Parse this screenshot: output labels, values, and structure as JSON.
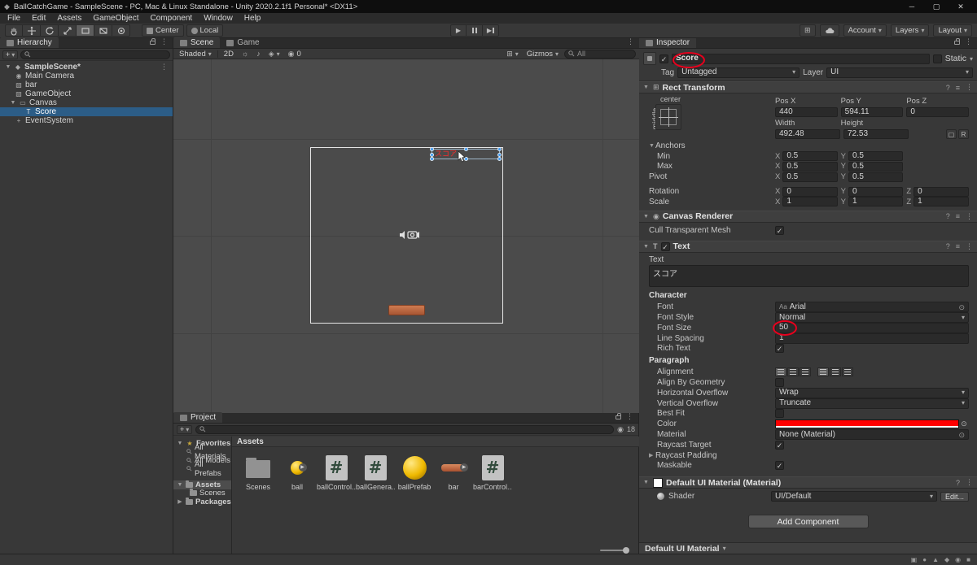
{
  "icons": {
    "chevron_down": "▾",
    "foldout_open": "▼",
    "foldout_closed": "▶",
    "menu_dots": "⋮",
    "check": "✓",
    "help": "?",
    "presets": "≡",
    "close": "✕",
    "minimize": "─",
    "maximize": "▢",
    "star": "★",
    "plus": "+",
    "picker": "⊙",
    "play": "▶",
    "grid": "⊞",
    "light": "☼",
    "audio": "♪",
    "fx": "◈",
    "eye": "◉",
    "unity_logo": "◆",
    "scene_asset": "◆",
    "camera": "◉",
    "cube": "▧",
    "canvas": "▭",
    "text": "T",
    "gear": "+",
    "hash": "#"
  },
  "title_bar": {
    "title": "BallCatchGame - SampleScene - PC, Mac & Linux Standalone - Unity 2020.2.1f1 Personal* <DX11>"
  },
  "menu_bar": {
    "items": [
      "File",
      "Edit",
      "Assets",
      "GameObject",
      "Component",
      "Window",
      "Help"
    ]
  },
  "toolbar": {
    "pivot_button": "Center",
    "rotation_button": "Local",
    "account_button": "Account",
    "layers_button": "Layers",
    "layout_button": "Layout"
  },
  "hierarchy": {
    "tab": "Hierarchy",
    "scene_row": "SampleScene*",
    "rows": [
      {
        "label": "Main Camera"
      },
      {
        "label": "bar"
      },
      {
        "label": "GameObject"
      },
      {
        "label": "Canvas"
      },
      {
        "label": "Score"
      },
      {
        "label": "EventSystem"
      }
    ]
  },
  "scene": {
    "tab_scene": "Scene",
    "tab_game": "Game",
    "shading_dropdown": "Shaded",
    "mode_2d": "2D",
    "hidden_count": "0",
    "gizmos_dropdown": "Gizmos",
    "search_value": "All",
    "score_text": "スコア"
  },
  "project": {
    "tab": "Project",
    "hidden_count": "18",
    "favorites_label": "Favorites",
    "favorites": [
      "All Materials",
      "All Models",
      "All Prefabs"
    ],
    "assets_label": "Assets",
    "scenes_label": "Scenes",
    "packages_label": "Packages",
    "breadcrumb": "Assets",
    "assets": [
      {
        "name": "Scenes",
        "type": "folder"
      },
      {
        "name": "ball",
        "type": "material"
      },
      {
        "name": "ballControl...",
        "type": "script"
      },
      {
        "name": "ballGenera...",
        "type": "script"
      },
      {
        "name": "ballPrefab",
        "type": "prefab"
      },
      {
        "name": "bar",
        "type": "prefab"
      },
      {
        "name": "barControl...",
        "type": "script"
      }
    ]
  },
  "inspector": {
    "tab": "Inspector",
    "name_field": "Score",
    "static_label": "Static",
    "tag_label": "Tag",
    "tag_value": "Untagged",
    "layer_label": "Layer",
    "layer_value": "UI",
    "rect_transform": {
      "title": "Rect Transform",
      "anchor_horizontal": "center",
      "anchor_vertical": "middle",
      "pos_x_label": "Pos X",
      "pos_x": "440",
      "pos_y_label": "Pos Y",
      "pos_y": "594.11",
      "pos_z_label": "Pos Z",
      "pos_z": "0",
      "width_label": "Width",
      "width": "492.48",
      "height_label": "Height",
      "height": "72.53",
      "raw_edit": "R",
      "anchors_label": "Anchors",
      "min_label": "Min",
      "min_x": "0.5",
      "min_y": "0.5",
      "max_label": "Max",
      "max_x": "0.5",
      "max_y": "0.5",
      "pivot_label": "Pivot",
      "pivot_x": "0.5",
      "pivot_y": "0.5",
      "rotation_label": "Rotation",
      "rot_x": "0",
      "rot_y": "0",
      "rot_z": "0",
      "scale_label": "Scale",
      "scale_x": "1",
      "scale_y": "1",
      "scale_z": "1",
      "x": "X",
      "y": "Y",
      "z": "Z"
    },
    "canvas_renderer": {
      "title": "Canvas Renderer",
      "cull_label": "Cull Transparent Mesh"
    },
    "text": {
      "title": "Text",
      "text_label": "Text",
      "text_value": "スコア",
      "character_label": "Character",
      "font_label": "Font",
      "font_value": "Arial",
      "font_style_label": "Font Style",
      "font_style_value": "Normal",
      "font_size_label": "Font Size",
      "font_size_value": "50",
      "line_spacing_label": "Line Spacing",
      "line_spacing_value": "1",
      "rich_text_label": "Rich Text",
      "paragraph_label": "Paragraph",
      "alignment_label": "Alignment",
      "align_by_geometry_label": "Align By Geometry",
      "horizontal_overflow_label": "Horizontal Overflow",
      "horizontal_overflow_value": "Wrap",
      "vertical_overflow_label": "Vertical Overflow",
      "vertical_overflow_value": "Truncate",
      "best_fit_label": "Best Fit",
      "color_label": "Color",
      "color_value": "#FF0000",
      "material_label": "Material",
      "material_value": "None (Material)",
      "raycast_target_label": "Raycast Target",
      "raycast_padding_label": "Raycast Padding",
      "maskable_label": "Maskable"
    },
    "material_section": {
      "title": "Default UI Material (Material)",
      "shader_label": "Shader",
      "shader_value": "UI/Default",
      "edit_button": "Edit..."
    },
    "add_component_button": "Add Component",
    "preview_bar": "Default UI Material"
  },
  "colors": {
    "selection_blue": "#2C5D87",
    "annotation_red": "#E8001D",
    "text_red": "#FF0000",
    "ball_yellow": "#EFB900",
    "bar_orange": "#A9502F"
  }
}
